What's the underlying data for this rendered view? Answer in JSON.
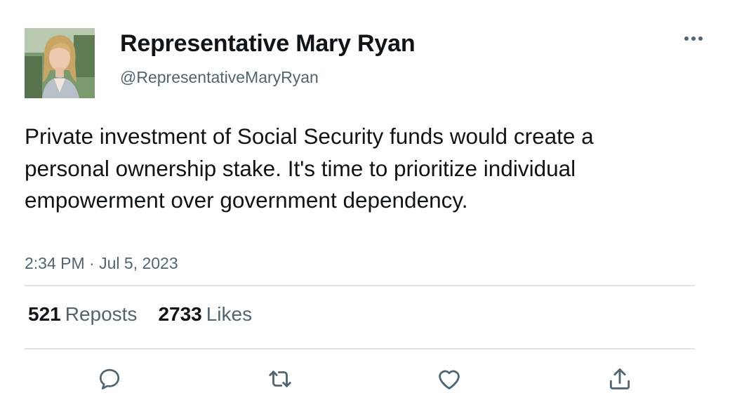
{
  "author": {
    "display_name": "Representative Mary Ryan",
    "handle": "@RepresentativeMaryRyan"
  },
  "tweet": {
    "text": "Private investment of Social Security funds would create a personal ownership stake. It's time to prioritize individual empowerment over government dependency.",
    "timestamp": "2:34 PM · Jul 5, 2023"
  },
  "stats": {
    "reposts_count": "521",
    "reposts_label": "Reposts",
    "likes_count": "2733",
    "likes_label": "Likes"
  },
  "icons": {
    "more": "more-horizontal-icon",
    "reply": "reply-icon",
    "repost": "repost-icon",
    "like": "heart-icon",
    "share": "share-icon"
  },
  "colors": {
    "text_primary": "#0f1419",
    "text_secondary": "#536471",
    "divider": "#dfe3e6"
  }
}
